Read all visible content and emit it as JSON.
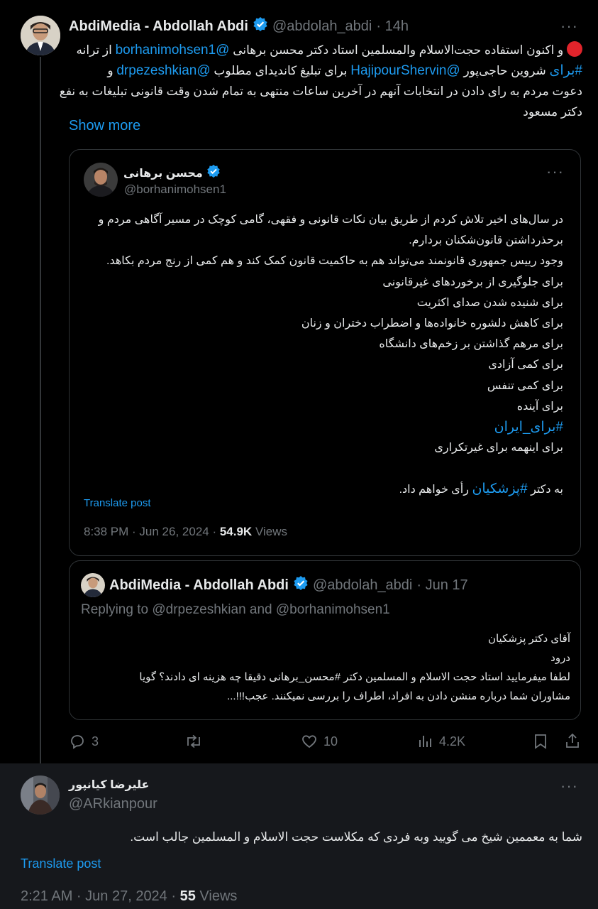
{
  "main_post": {
    "display_name": "AbdiMedia - Abdollah Abdi",
    "handle": "@abdolah_abdi",
    "time": "· 14h",
    "text_line1_prefix": "از ترانه",
    "text_line1_mention": "@borhanimohsen1",
    "text_line1_rest": "و اکنون استفاده حجت‌الاسلام والمسلمین استاد دکتر محسن برهانی",
    "text_line2_hashtag": "#برای",
    "text_line2_a": "شروین حاجی‌پور",
    "text_line2_mention1": "@HajipourShervin",
    "text_line2_b": "برای تبلیغ کاندیدای مطلوب",
    "text_line2_mention2": "@drpezeshkian",
    "text_line2_c": "و",
    "text_line3": "دعوت مردم به رای دادن در انتخابات آنهم در آخرین ساعات منتهی به تمام شدن وقت قانونی تبلیغات به نفع",
    "text_line4": "دکتر مسعود",
    "show_more": "Show more"
  },
  "quoted_post": {
    "display_name": "محسن برهانی",
    "handle": "@borhanimohsen1",
    "lines": [
      "در سال‌های اخیر تلاش کردم از طریق بیان نکات قانونی و فقهی، گامی کوچک در مسیر آگاهی مردم و",
      "برحذرداشتن قانون‌شکنان بردارم.",
      "وجود رییس جمهوری قانونمند می‌تواند هم به حاکمیت قانون کمک کند و هم کمی از رنج مردم بکاهد.",
      "برای جلوگیری از برخوردهای غیرقانونی",
      "برای شنیده شدن صدای اکثریت",
      "برای کاهش دلشوره خانواده‌ها و اضطراب دختران و زنان",
      "برای مرهم گذاشتن بر زخم‌های دانشگاه",
      "برای کمی آزادی",
      "برای کمی تنفس",
      "برای آینده"
    ],
    "hashtag_line": "#برای_ایران",
    "line_after": "برای اینهمه برای غیرتکراری",
    "final_prefix": "به دکتر",
    "final_hashtag": "#پزشکیان",
    "final_suffix": "رأی خواهم داد.",
    "translate": "Translate post",
    "timestamp": "8:38 PM · Jun 26, 2024 · ",
    "views_count": "54.9K",
    "views_label": " Views"
  },
  "nested_quote": {
    "display_name": "AbdiMedia - Abdollah Abdi",
    "handle": "@abdolah_abdi",
    "time": "· Jun 17",
    "replying": "Replying to @drpezeshkian and @borhanimohsen1",
    "lines": [
      "آقای دکتر پزشکیان",
      "درود",
      "لطفا میفرمایید استاد حجت الاسلام و المسلمین دکتر #محسن_برهانی دقیقا چه هزینه ای دادند؟ گویا",
      "مشاوران شما درباره منشن دادن به افراد، اطراف را بررسی نمیکنند. عجب!!!..."
    ]
  },
  "actions": {
    "replies": "3",
    "reposts": "",
    "likes": "10",
    "views": "4.2K"
  },
  "reply_post": {
    "display_name": "علیرضا کیانپور",
    "handle": "@ARkianpour",
    "text": "شما به معممین شیخ می گویید وبه فردی که مکلاست حجت الاسلام و المسلمین جالب است.",
    "translate": "Translate post",
    "timestamp": "2:21 AM · Jun 27, 2024 · ",
    "views_count": "55",
    "views_label": " Views"
  },
  "colors": {
    "background": "#000000",
    "text": "#e7e9ea",
    "muted": "#71767b",
    "link": "#1d9bf0",
    "border": "#2f3336",
    "verified": "#1d9bf0"
  }
}
